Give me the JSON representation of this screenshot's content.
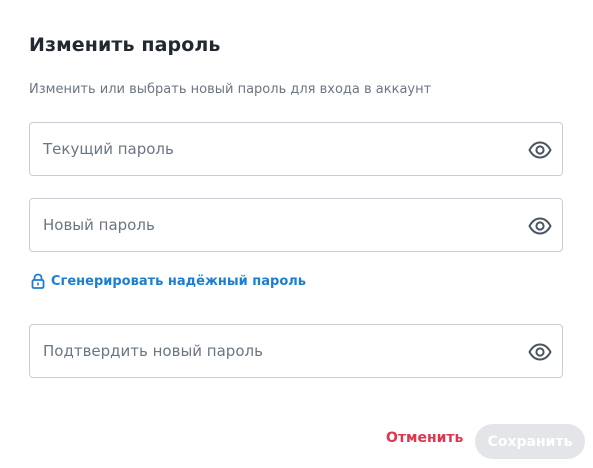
{
  "dialog": {
    "title": "Изменить пароль",
    "subtitle": "Изменить или выбрать новый пароль для входа в аккаунт"
  },
  "fields": {
    "current_password": {
      "value": "",
      "placeholder": "Текущий пароль",
      "icon": "eye-icon"
    },
    "new_password": {
      "value": "",
      "placeholder": "Новый пароль",
      "icon": "eye-icon"
    },
    "confirm_password": {
      "value": "",
      "placeholder": "Подтвердить новый пароль",
      "icon": "eye-icon"
    }
  },
  "generate_link": {
    "label": "Сгенерировать надёжный пароль",
    "icon": "lock-icon"
  },
  "actions": {
    "cancel_label": "Отменить",
    "save_label": "Сохранить"
  },
  "colors": {
    "title": "#222831",
    "muted_text": "#6b7683",
    "border": "#c9ced4",
    "link_blue": "#1a7fd0",
    "cancel_red": "#e0344f",
    "disabled_button_bg": "#e3e5e8"
  }
}
